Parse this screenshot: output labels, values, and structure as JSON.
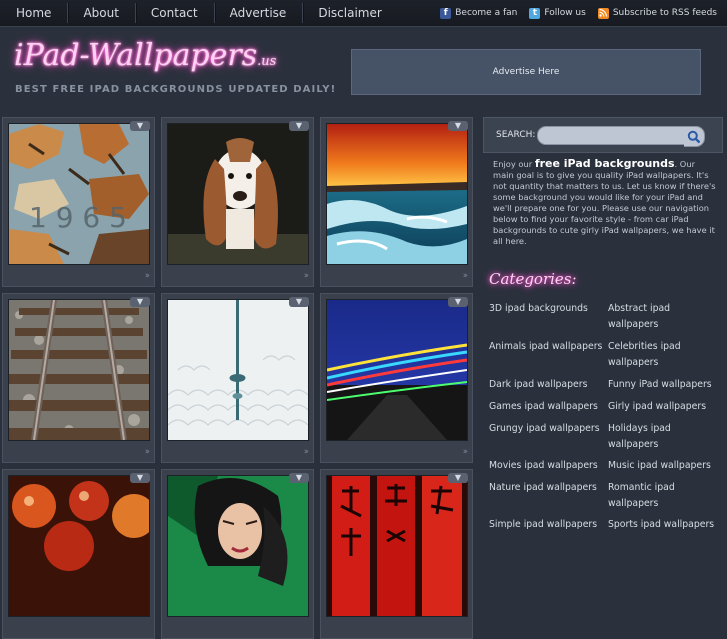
{
  "nav": {
    "items": [
      "Home",
      "About",
      "Contact",
      "Advertise",
      "Disclaimer"
    ]
  },
  "social": {
    "facebook": "Become a fan",
    "twitter": "Follow us",
    "rss": "Subscribe to RSS feeds"
  },
  "header": {
    "logo_main": "iPad-Wallpapers",
    "logo_tld": ".us",
    "tagline": "BEST FREE IPAD BACKGROUNDS UPDATED DAILY!",
    "ad_text": "Advertise Here"
  },
  "wallpapers": [
    {
      "subject": "peeling paint with number 1965"
    },
    {
      "subject": "basset hound puppy"
    },
    {
      "subject": "ocean wave at sunset"
    },
    {
      "subject": "railroad tracks"
    },
    {
      "subject": "tower in the clouds"
    },
    {
      "subject": "city light trails at night"
    },
    {
      "subject": "christmas ornaments"
    },
    {
      "subject": "woman portrait"
    },
    {
      "subject": "red chinese banners"
    }
  ],
  "sidebar": {
    "search_label": "SEARCH:",
    "intro_start": "Enjoy our ",
    "intro_bold": "free iPad backgrounds",
    "intro_rest": ". Our main goal is to give you quality iPad wallpapers. It's not quantity that matters to us. Let us know if there's some background you would like for your iPad and we'll prepare one for you. Please use our navigation below to find your favorite style - from car iPad backgrounds to cute girly iPad wallpapers, we have it all here.",
    "categories_title": "Categories:",
    "categories_left": [
      "3D ipad backgrounds",
      "Animals ipad wallpapers",
      "Dark ipad wallpapers",
      "Games ipad wallpapers",
      "Grungy ipad wallpapers",
      "Movies ipad wallpapers",
      "Nature ipad wallpapers",
      "Simple ipad wallpapers"
    ],
    "categories_right": [
      "Abstract ipad wallpapers",
      "Celebrities ipad wallpapers",
      "Funny iPad wallpapers",
      "Girly ipad wallpapers",
      "Holidays ipad wallpapers",
      "Music ipad wallpapers",
      "Romantic ipad wallpapers",
      "Sports ipad wallpapers"
    ]
  },
  "colors": {
    "background": "#2b313c",
    "neon_pink": "#ff5fd6",
    "ad_box": "#465266"
  }
}
